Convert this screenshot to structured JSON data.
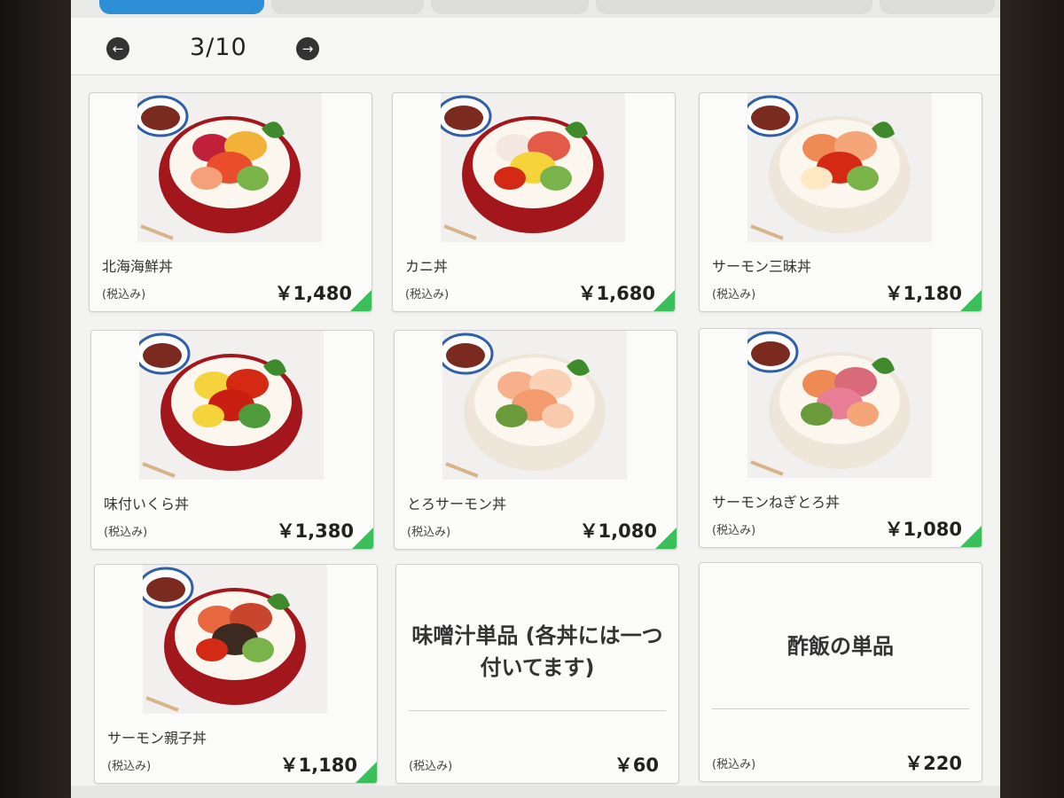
{
  "tabs": [
    {
      "label": "",
      "active": true
    },
    {
      "label": "",
      "active": false
    },
    {
      "label": "",
      "active": false
    },
    {
      "label": "",
      "active": false
    },
    {
      "label": "",
      "active": false
    }
  ],
  "pager": {
    "current": "3/10",
    "prev_icon": "arrow-left-icon",
    "next_icon": "arrow-right-icon"
  },
  "items": [
    {
      "name": "北海海鮮丼",
      "tax": "(税込み)",
      "price": "￥1,480",
      "bowl": "red",
      "topping": "mixed"
    },
    {
      "name": "カニ丼",
      "tax": "(税込み)",
      "price": "￥1,680",
      "bowl": "red",
      "topping": "crab"
    },
    {
      "name": "サーモン三昧丼",
      "tax": "(税込み)",
      "price": "￥1,180",
      "bowl": "white",
      "topping": "salmon"
    },
    {
      "name": "味付いくら丼",
      "tax": "(税込み)",
      "price": "￥1,380",
      "bowl": "red",
      "topping": "ikura"
    },
    {
      "name": "とろサーモン丼",
      "tax": "(税込み)",
      "price": "￥1,080",
      "bowl": "white",
      "topping": "toro"
    },
    {
      "name": "サーモンねぎとろ丼",
      "tax": "(税込み)",
      "price": "￥1,080",
      "bowl": "white",
      "topping": "negitoro"
    },
    {
      "name": "サーモン親子丼",
      "tax": "(税込み)",
      "price": "￥1,180",
      "bowl": "red",
      "topping": "oyako"
    },
    {
      "title": "味噌汁単品 (各丼には一つ付いてます)",
      "tax": "(税込み)",
      "price": "￥60"
    },
    {
      "title": "酢飯の単品",
      "tax": "(税込み)",
      "price": "￥220"
    }
  ],
  "colors": {
    "accent": "#2d8fd6",
    "corner": "#3bbf5a",
    "bowl_red": "#a3161b",
    "salmon": "#f08a55",
    "ikura": "#d42a14"
  }
}
